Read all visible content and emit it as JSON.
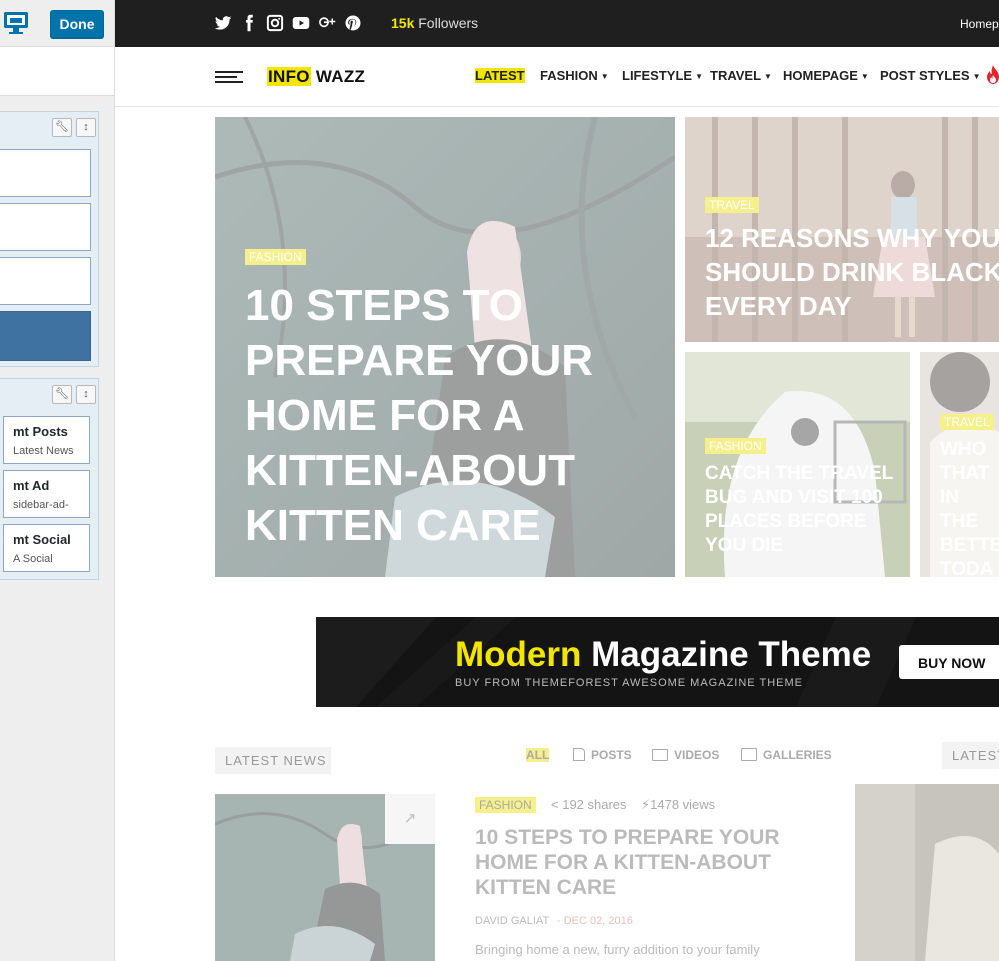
{
  "customizer": {
    "done_label": "Done",
    "widgets": [
      {
        "title": "mt Posts",
        "subtitle": "Latest News"
      },
      {
        "title": "mt Ad",
        "subtitle": "sidebar-ad-"
      },
      {
        "title": "mt Social",
        "subtitle": "A Social"
      }
    ]
  },
  "topbar": {
    "social_icons": [
      "twitter-icon",
      "facebook-icon",
      "instagram-icon",
      "youtube-icon",
      "google-plus-icon",
      "pinterest-icon"
    ],
    "followers_count": "15k",
    "followers_label": "Followers",
    "right_link": "Homep"
  },
  "nav": {
    "logo_part1": "INFO",
    "logo_part2": "WAZZ",
    "items": [
      "LATEST",
      "FASHION",
      "LIFESTYLE",
      "TRAVEL",
      "HOMEPAGE",
      "POST STYLES"
    ]
  },
  "featured": {
    "main": {
      "category": "FASHION",
      "title": "10 STEPS TO PREPARE YOUR HOME FOR A KITTEN-ABOUT KITTEN CARE"
    },
    "top_right": {
      "category": "TRAVEL",
      "title": "12 REASONS WHY YOU SHOULD DRINK BLACK EVERY DAY"
    },
    "bottom_left": {
      "category": "FASHION",
      "title": "CATCH THE TRAVEL BUG AND VISIT 100 PLACES BEFORE YOU DIE"
    },
    "bottom_right": {
      "category": "TRAVEL",
      "title": "WHO THAT IN THE BETTE TODA"
    }
  },
  "banner": {
    "title_highlight": "Modern",
    "title_rest": "Magazine Theme",
    "subtitle": "BUY FROM THEMEFOREST AWESOME MAGAZINE THEME",
    "button_label": "BUY NOW"
  },
  "latest": {
    "section_label": "LATEST NEWS",
    "section_label_right": "LATEST",
    "filter_tabs": [
      "ALL",
      "POSTS",
      "VIDEOS",
      "GALLERIES"
    ],
    "post": {
      "category": "FASHION",
      "shares": "192 shares",
      "views": "1478 views",
      "title": "10 STEPS TO PREPARE YOUR HOME FOR A KITTEN-ABOUT KITTEN CARE",
      "author": "DAVID GALIAT",
      "date": "- DEC 02, 2016",
      "excerpt": "Bringing home a new, furry addition to your family"
    }
  },
  "colors": {
    "accent_yellow": "#f2e600",
    "customizer_blue": "#0073aa",
    "topbar_bg": "#1f1f1f"
  }
}
